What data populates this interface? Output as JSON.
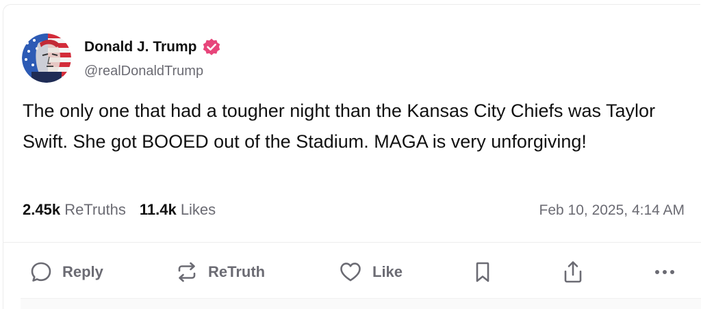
{
  "author": {
    "display_name": "Donald J. Trump",
    "handle": "@realDonaldTrump",
    "verified": true,
    "verified_color": "#e7457a"
  },
  "post": {
    "text": "The only one that had a tougher night than the Kansas City Chiefs was Taylor Swift. She got BOOED out of the Stadium. MAGA is very unforgiving!",
    "retruths_count": "2.45k",
    "retruths_label": "ReTruths",
    "likes_count": "11.4k",
    "likes_label": "Likes",
    "timestamp": "Feb 10, 2025, 4:14 AM"
  },
  "actions": {
    "reply_label": "Reply",
    "retruth_label": "ReTruth",
    "like_label": "Like",
    "icons": [
      "reply-icon",
      "retruth-icon",
      "like-icon",
      "bookmark-icon",
      "share-icon",
      "more-icon"
    ]
  },
  "colors": {
    "text_primary": "#111111",
    "text_secondary": "#6b6b73",
    "divider": "#ececec"
  }
}
